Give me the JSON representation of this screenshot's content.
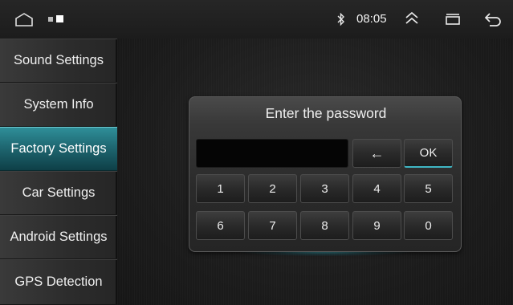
{
  "status_bar": {
    "time": "08:05",
    "icons": [
      "home-outline-icon",
      "notification-square-icon",
      "bluetooth-icon",
      "double-chevron-up-icon",
      "recent-apps-icon",
      "back-icon"
    ]
  },
  "sidebar": {
    "items": [
      {
        "label": "Sound Settings",
        "active": false
      },
      {
        "label": "System Info",
        "active": false
      },
      {
        "label": "Factory Settings",
        "active": true
      },
      {
        "label": "Car Settings",
        "active": false
      },
      {
        "label": "Android Settings",
        "active": false
      },
      {
        "label": "GPS Detection",
        "active": false
      }
    ]
  },
  "dialog": {
    "title": "Enter the password",
    "password_value": "",
    "backspace_label": "←",
    "ok_label": "OK",
    "keys_row1": [
      "1",
      "2",
      "3",
      "4",
      "5"
    ],
    "keys_row2": [
      "6",
      "7",
      "8",
      "9",
      "0"
    ]
  },
  "colors": {
    "accent": "#1f6872",
    "accent_highlight": "#3fb6c4",
    "background": "#1a1a1a"
  }
}
